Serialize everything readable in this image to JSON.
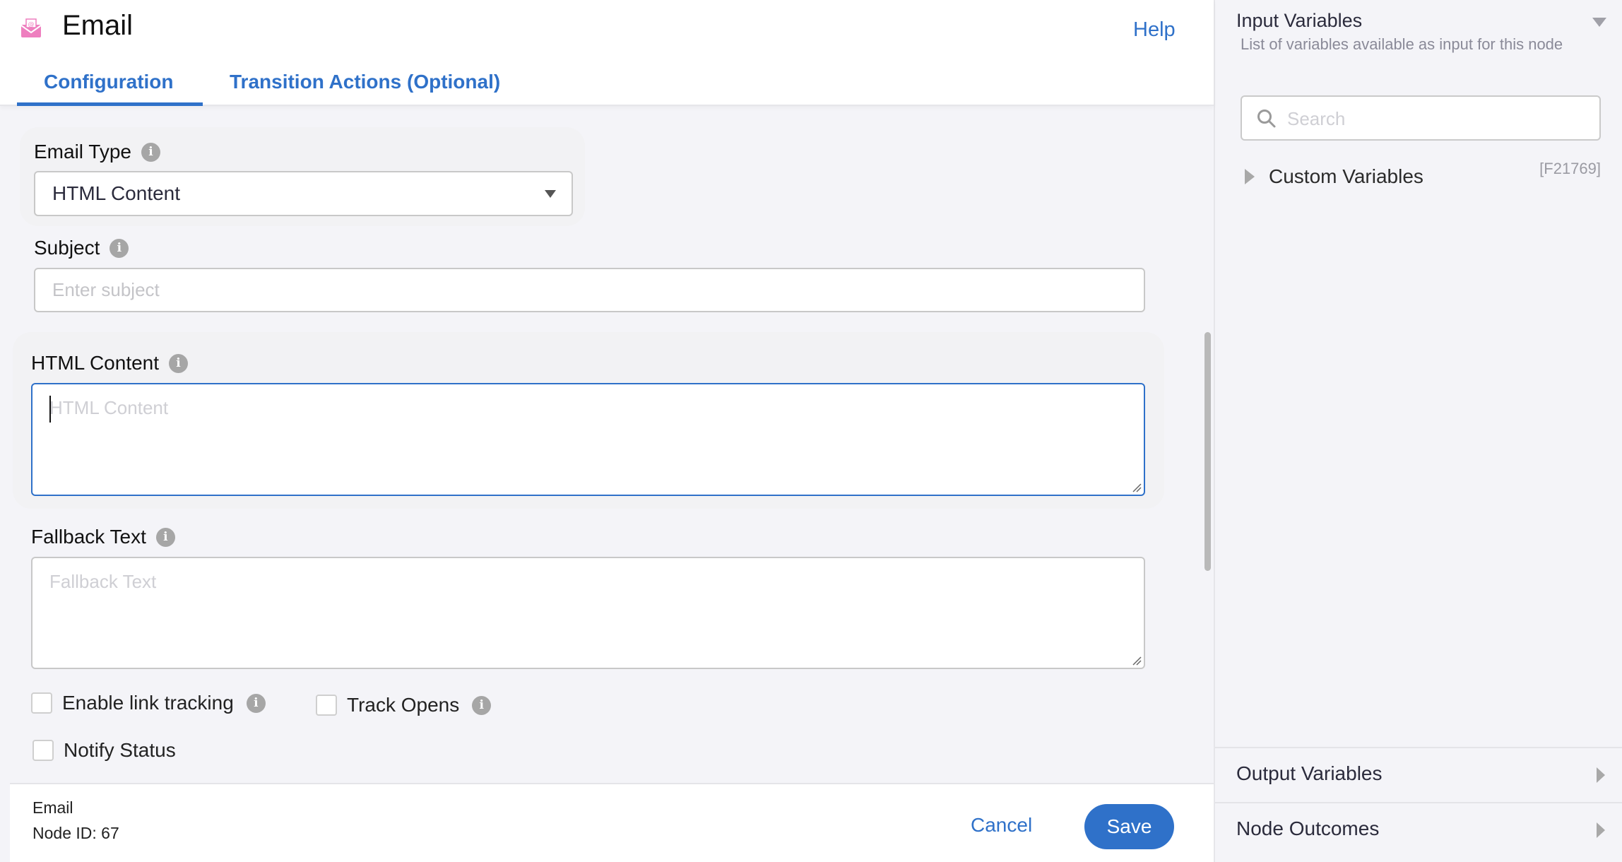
{
  "header": {
    "title": "Email",
    "icon": "email-envelope-icon",
    "help_label": "Help",
    "tabs": [
      {
        "label": "Configuration",
        "active": true
      },
      {
        "label": "Transition Actions (Optional)",
        "active": false
      }
    ]
  },
  "form": {
    "email_type": {
      "label": "Email Type",
      "value": "HTML Content"
    },
    "subject": {
      "label": "Subject",
      "placeholder": "Enter subject",
      "value": ""
    },
    "html_content": {
      "label": "HTML Content",
      "placeholder": "HTML Content",
      "value": ""
    },
    "fallback_text": {
      "label": "Fallback Text",
      "placeholder": "Fallback Text",
      "value": ""
    },
    "checkboxes": [
      {
        "label": "Enable link tracking",
        "checked": false,
        "has_info": true
      },
      {
        "label": "Track Opens",
        "checked": false,
        "has_info": true
      },
      {
        "label": "Notify Status",
        "checked": false,
        "has_info": false
      }
    ]
  },
  "footer": {
    "node_name": "Email",
    "node_id_label": "Node ID: 67",
    "cancel_label": "Cancel",
    "save_label": "Save"
  },
  "side_panel": {
    "input_variables": {
      "title": "Input Variables",
      "description": "List of variables available as input for this node",
      "search_placeholder": "Search",
      "items": [
        {
          "label": "Custom Variables",
          "code": "[F21769]"
        }
      ]
    },
    "sections": [
      {
        "label": "Output Variables"
      },
      {
        "label": "Node Outcomes"
      }
    ]
  },
  "colors": {
    "accent": "#2f71c9",
    "icon_pink": "#ee7fbf"
  }
}
